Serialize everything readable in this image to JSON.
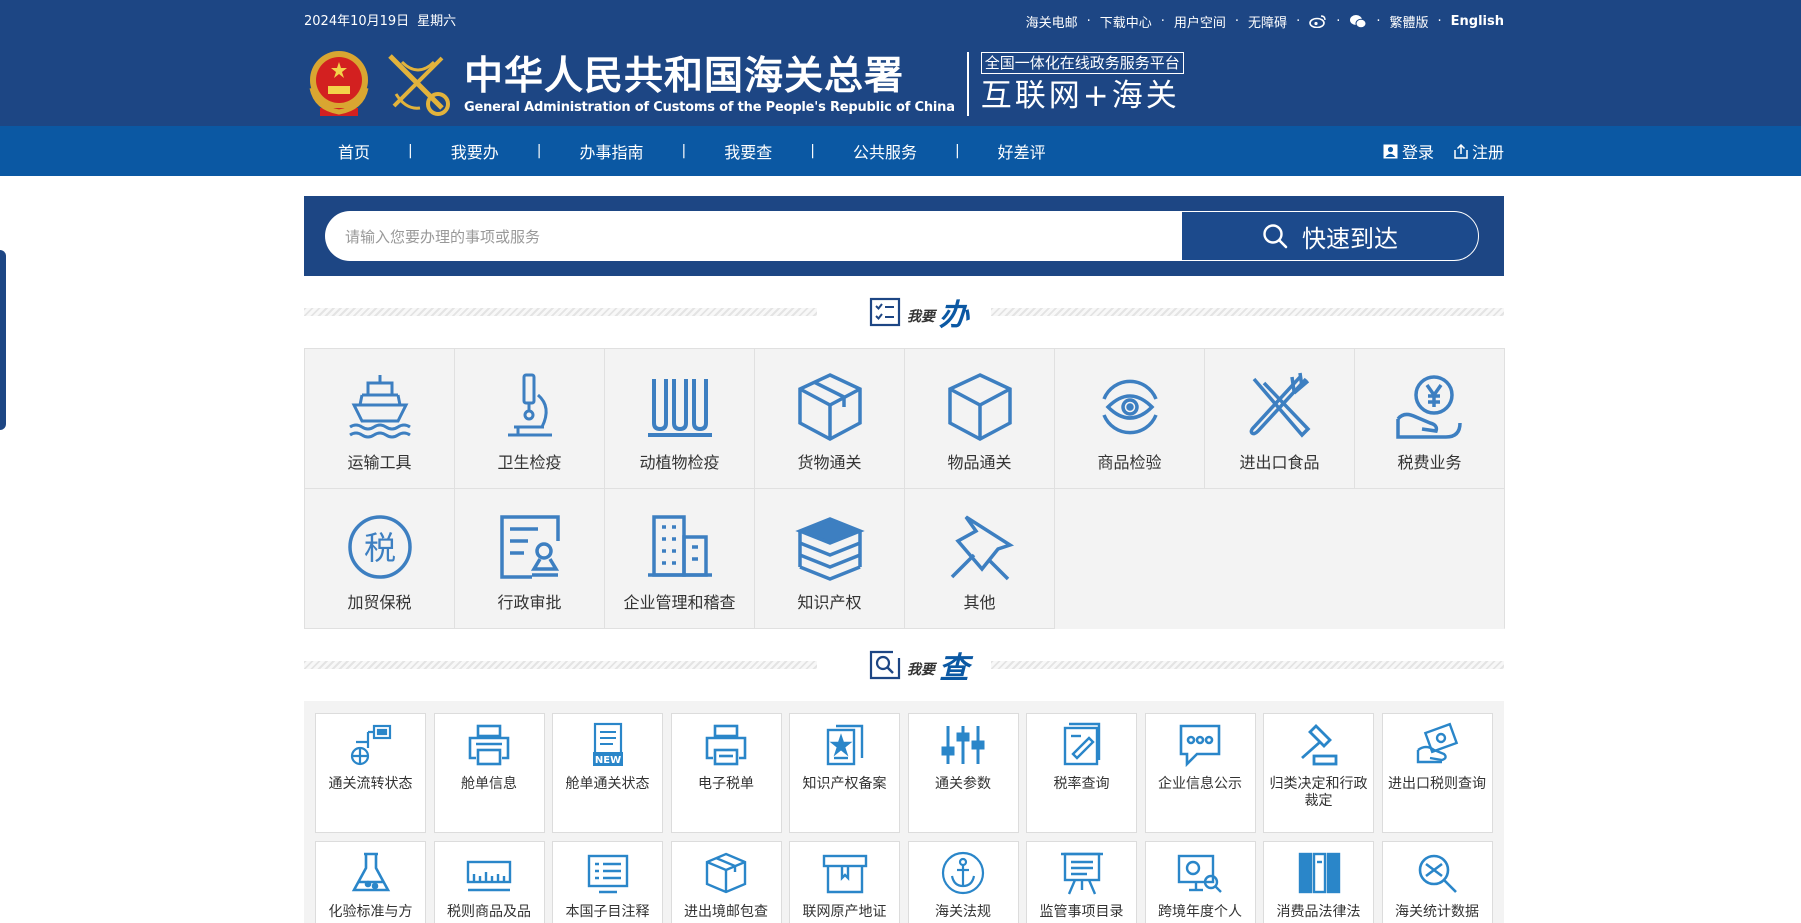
{
  "header": {
    "date": "2024年10月19日",
    "weekday": "星期六",
    "links": [
      "海关电邮",
      "下载中心",
      "用户空间",
      "无障碍"
    ],
    "lang_trad": "繁體版",
    "lang_en": "English",
    "title_cn": "中华人民共和国海关总署",
    "title_en": "General Administration of Customs of the People's Republic of China",
    "platform_top": "全国一体化在线政务服务平台",
    "platform_bottom": "互联网+海关"
  },
  "nav": {
    "items": [
      "首页",
      "我要办",
      "办事指南",
      "我要查",
      "公共服务",
      "好差评"
    ],
    "separator": "|",
    "login": "登录",
    "register": "注册"
  },
  "search": {
    "placeholder": "请输入您要办理的事项或服务",
    "button": "快速到达"
  },
  "section_do": {
    "small": "我要",
    "big": "办"
  },
  "services": [
    "运输工具",
    "卫生检疫",
    "动植物检疫",
    "货物通关",
    "物品通关",
    "商品检验",
    "进出口食品",
    "税费业务",
    "加贸保税",
    "行政审批",
    "企业管理和稽查",
    "知识产权",
    "其他"
  ],
  "section_query": {
    "small": "我要",
    "big": "查"
  },
  "queries": [
    "通关流转状态",
    "舱单信息",
    "舱单通关状态",
    "电子税单",
    "知识产权备案",
    "通关参数",
    "税率查询",
    "企业信息公示",
    "归类决定和行政裁定",
    "进出口税则查询",
    "化验标准与方",
    "税则商品及品",
    "本国子目注释",
    "进出境邮包查",
    "联网原产地证",
    "海关法规",
    "监管事项目录",
    "跨境年度个人",
    "消费品法律法",
    "海关统计数据"
  ],
  "colors": {
    "navy": "#1d4684",
    "nav_blue": "#0b58a3",
    "icon_blue": "#3d7fc1",
    "query_icon": "#2a86c9"
  }
}
